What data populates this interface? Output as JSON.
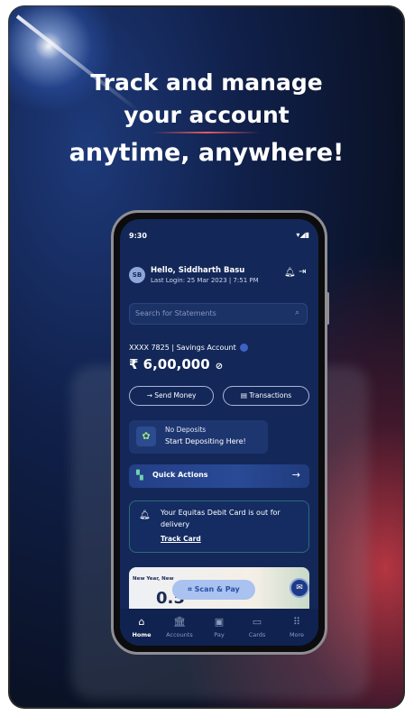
{
  "promo": {
    "line1": "Track and manage",
    "line2": "your account",
    "line3": "anytime, anywhere!",
    "accent_color": "#e85a5a"
  },
  "status_bar": {
    "time": "9:30",
    "icons": "wifi-signal-battery"
  },
  "greeting": {
    "avatar_initials": "SB",
    "hello": "Hello, Siddharth Basu",
    "last_login": "Last Login: 25 Mar 2023 | 7:51 PM",
    "bell_icon": "bell-icon",
    "logout_icon": "logout-icon"
  },
  "search": {
    "placeholder": "Search for Statements"
  },
  "account": {
    "label": "XXXX 7825 | Savings Account",
    "balance": "₹ 6,00,000"
  },
  "actions": {
    "send_money": "→  Send Money",
    "transactions": "▤  Transactions"
  },
  "deposit": {
    "title": "No Deposits",
    "subtitle": "Start Depositing Here!"
  },
  "quick_actions": {
    "label": "Quick Actions"
  },
  "card_notice": {
    "text": "Your Equitas Debit Card is out for delivery",
    "link": "Track Card"
  },
  "banner": {
    "text": "New Year, New",
    "big": "0.5"
  },
  "scan_pay": {
    "label": "Scan & Pay"
  },
  "bottom_nav": [
    {
      "label": "Home",
      "icon": "home-icon",
      "glyph": "⌂",
      "active": true
    },
    {
      "label": "Accounts",
      "icon": "bank-icon",
      "glyph": "🏛",
      "active": false
    },
    {
      "label": "Pay",
      "icon": "pay-icon",
      "glyph": "▣",
      "active": false
    },
    {
      "label": "Cards",
      "icon": "card-icon",
      "glyph": "▭",
      "active": false
    },
    {
      "label": "More",
      "icon": "grid-icon",
      "glyph": "⠿",
      "active": false
    }
  ]
}
